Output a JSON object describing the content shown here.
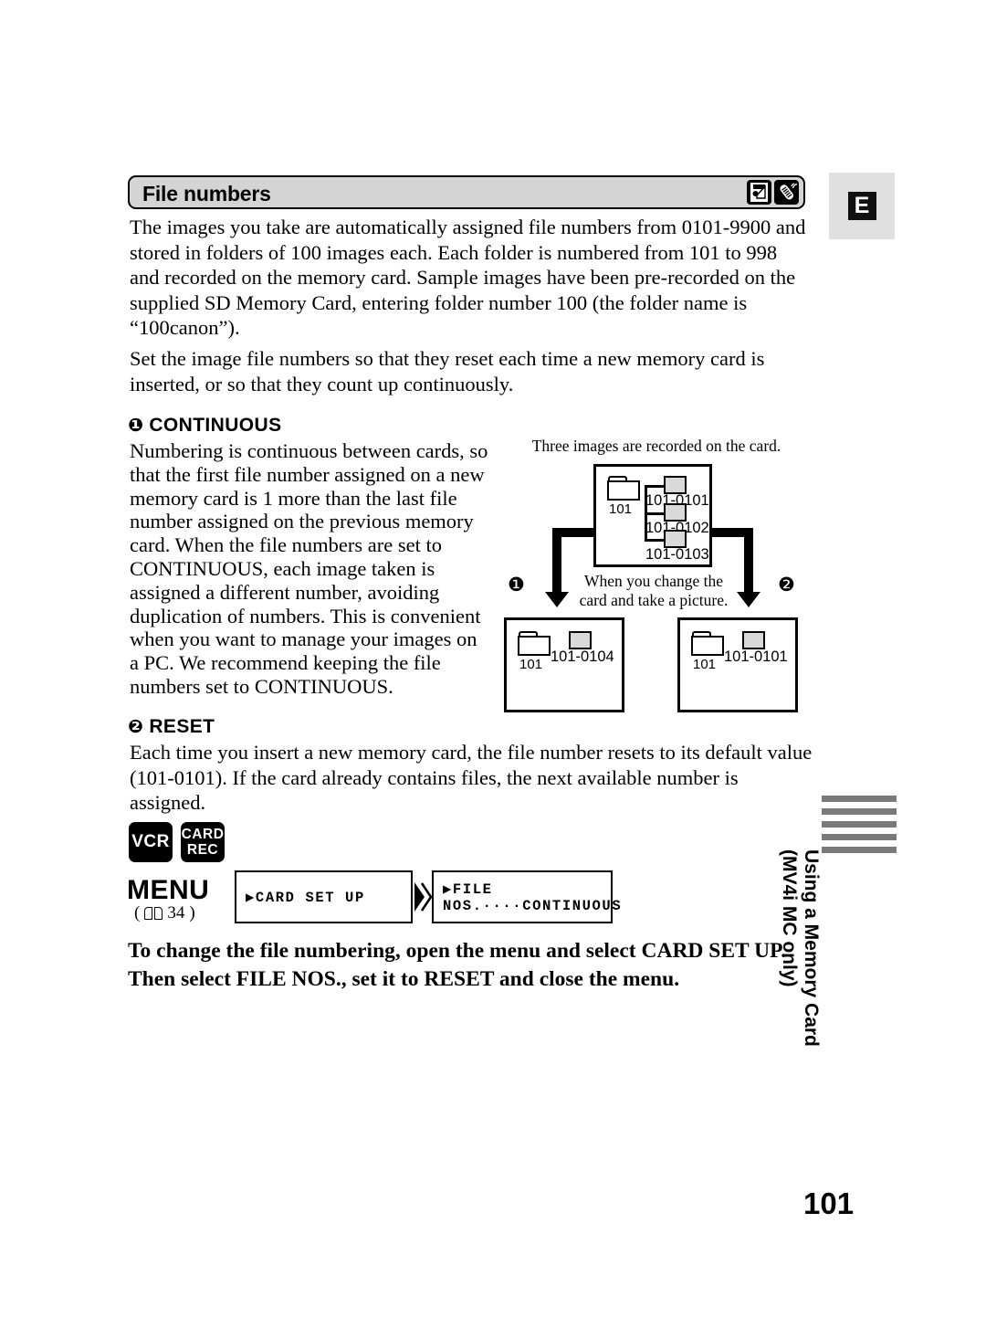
{
  "page": {
    "number": "101",
    "lang_badge": "E"
  },
  "header": {
    "title": "File numbers",
    "icons": [
      "memory-card-icon",
      "remote-control-icon"
    ]
  },
  "intro": {
    "paragraph1": "The images you take are automatically assigned file numbers from 0101-9900 and stored in folders of 100 images each. Each folder is numbered from 101 to 998 and recorded on the memory card. Sample images have been pre-recorded on the supplied SD Memory Card, entering folder number 100 (the folder name is “100canon”).",
    "paragraph2": "Set the image file numbers so that they reset each time a new memory card is inserted, or so that they count up continuously."
  },
  "sections": [
    {
      "marker": "❶",
      "heading": "CONTINUOUS",
      "body": "Numbering is continuous between cards, so that the first file number assigned on a new memory card is 1 more than the last file number assigned on the previous memory card. When the file numbers are set to CONTINUOUS, each image taken is assigned a different number, avoiding duplication of numbers. This is convenient when you want to manage your images on a PC. We recommend keeping the file numbers set to CONTINUOUS."
    },
    {
      "marker": "❷",
      "heading": "RESET",
      "body": "Each time you insert a new memory card, the file number resets to its default value (101-0101). If the card already contains files, the next available number is assigned."
    }
  ],
  "diagram": {
    "caption_top": "Three images are recorded on the card.",
    "caption_middle_line1": "When you change the",
    "caption_middle_line2": "card and take a picture.",
    "card_before": {
      "folder": "101",
      "files": [
        "101-0101",
        "101-0102",
        "101-0103"
      ]
    },
    "branch_left": {
      "marker": "❶",
      "folder": "101",
      "files": [
        "101-0104"
      ]
    },
    "branch_right": {
      "marker": "❷",
      "folder": "101",
      "files": [
        "101-0101"
      ]
    }
  },
  "modes": {
    "vcr": "VCR",
    "card_rec_line1": "CARD",
    "card_rec_line2": "REC"
  },
  "menu": {
    "label": "MENU",
    "reference_open": "(",
    "reference_page": "34",
    "reference_close": ")",
    "screen1": "▶CARD SET UP",
    "screen2": "▶FILE NOS.····CONTINUOUS"
  },
  "closing_instruction": "To change the file numbering, open the menu and select CARD SET UP. Then select FILE NOS., set it to RESET and close the menu.",
  "side_tab": {
    "line1": "Using a Memory Card",
    "line2": "(MV4i MC only)",
    "bar_count": 5,
    "bar_color": "#7a7a7a"
  }
}
